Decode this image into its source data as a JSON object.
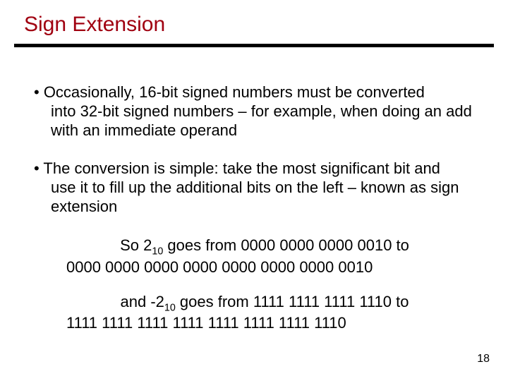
{
  "title": "Sign Extension",
  "bullets": [
    {
      "first": "• Occasionally, 16-bit signed numbers must be converted",
      "rest": "into 32-bit signed numbers – for example, when doing an add with an immediate operand"
    },
    {
      "first": "• The conversion is simple: take the most significant bit and",
      "rest": "use it to fill up the additional bits on the left – known as sign extension"
    }
  ],
  "examples": [
    {
      "prefix": "So 2",
      "sub": "10",
      "mid": " goes from  0000 0000 0000 0010   to",
      "line2": "0000 0000 0000 0000 0000 0000 0000 0010"
    },
    {
      "prefix": "and -2",
      "sub": "10",
      "mid": " goes from 1111 1111 1111 1110   to",
      "line2": "1111 1111 1111 1111 1111 1111 1111 1110"
    }
  ],
  "page_number": "18"
}
